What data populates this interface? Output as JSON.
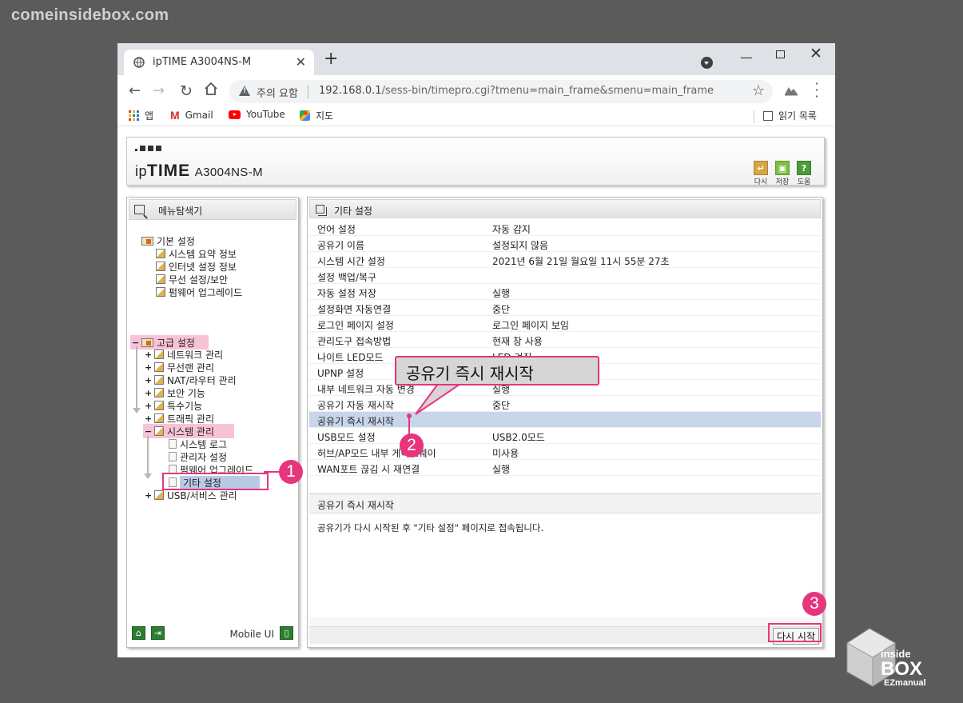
{
  "watermark": "comeinsidebox.com",
  "browser": {
    "tab_title": "ipTIME A3004NS-M",
    "security_label": "주의 요함",
    "url_host": "192.168.0.1",
    "url_path": "/sess-bin/timepro.cgi?tmenu=main_frame&smenu=main_frame",
    "bookmarks": [
      "앱",
      "Gmail",
      "YouTube",
      "지도"
    ],
    "reading_list": "읽기 목록"
  },
  "header": {
    "brand_prefix": "ip",
    "brand_bold": "TIME",
    "model": "A3004NS-M",
    "buttons": [
      {
        "label": "다시",
        "color": "#d9a443",
        "icon": "refresh-icon"
      },
      {
        "label": "저장",
        "color": "#7cbf3a",
        "icon": "save-icon"
      },
      {
        "label": "도움",
        "color": "#4d9a3a",
        "icon": "help-icon"
      }
    ]
  },
  "left_panel": {
    "title": "메뉴탐색기",
    "basic": {
      "label": "기본 설정",
      "items": [
        "시스템 요약 정보",
        "인터넷 설정 정보",
        "무선 설정/보안",
        "펌웨어 업그레이드"
      ]
    },
    "advanced": {
      "label": "고급 설정",
      "items": [
        "네트워크 관리",
        "무선랜 관리",
        "NAT/라우터 관리",
        "보안 기능",
        "특수기능",
        "트래픽 관리",
        "시스템 관리"
      ],
      "system_children": [
        "시스템 로그",
        "관리자 설정",
        "펌웨어 업그레이드",
        "기타 설정"
      ],
      "last_item": "USB/서비스 관리"
    },
    "mobile_ui": "Mobile UI"
  },
  "right_panel": {
    "title": "기타 설정",
    "rows": [
      {
        "key": "언어 설정",
        "value": "자동 감지"
      },
      {
        "key": "공유기 이름",
        "value": "설정되지 않음"
      },
      {
        "key": "시스템 시간 설정",
        "value": "2021년 6월 21일 월요일 11시 55분 27초"
      },
      {
        "key": "설정 백업/복구",
        "value": ""
      },
      {
        "key": "자동 설정 저장",
        "value": "실행"
      },
      {
        "key": "설정화면 자동연결",
        "value": "중단"
      },
      {
        "key": "로그인 페이지 설정",
        "value": "로그인 페이지 보임"
      },
      {
        "key": "관리도구 접속방법",
        "value": "현재 창 사용"
      },
      {
        "key": "나이트 LED모드",
        "value": "LED 켜짐"
      },
      {
        "key": "UPNP 설정",
        "value": ""
      },
      {
        "key": "내부 네트워크 자동 변경",
        "value": "실행"
      },
      {
        "key": "공유기 자동 재시작",
        "value": "중단"
      },
      {
        "key": "공유기 즉시 재시작",
        "value": ""
      },
      {
        "key": "USB모드 설정",
        "value": "USB2.0모드"
      },
      {
        "key": "허브/AP모드 내부 게이트웨이",
        "value": "미사용"
      },
      {
        "key": "WAN포트 끊김 시 재연결",
        "value": "실행"
      }
    ],
    "active_index": 12,
    "desc_title": "공유기 즉시 재시작",
    "desc_body": "공유기가 다시 시작된 후 \"기타 설정\" 페이지로 접속됩니다.",
    "restart_button": "다시 시작"
  },
  "annotations": {
    "callout": "공유기 즉시 재시작",
    "steps": [
      "1",
      "2",
      "3"
    ],
    "accent": "#e6357d"
  },
  "brand_badge": {
    "top": "inside",
    "middle": "BOX",
    "bottom": "EZmanual"
  }
}
